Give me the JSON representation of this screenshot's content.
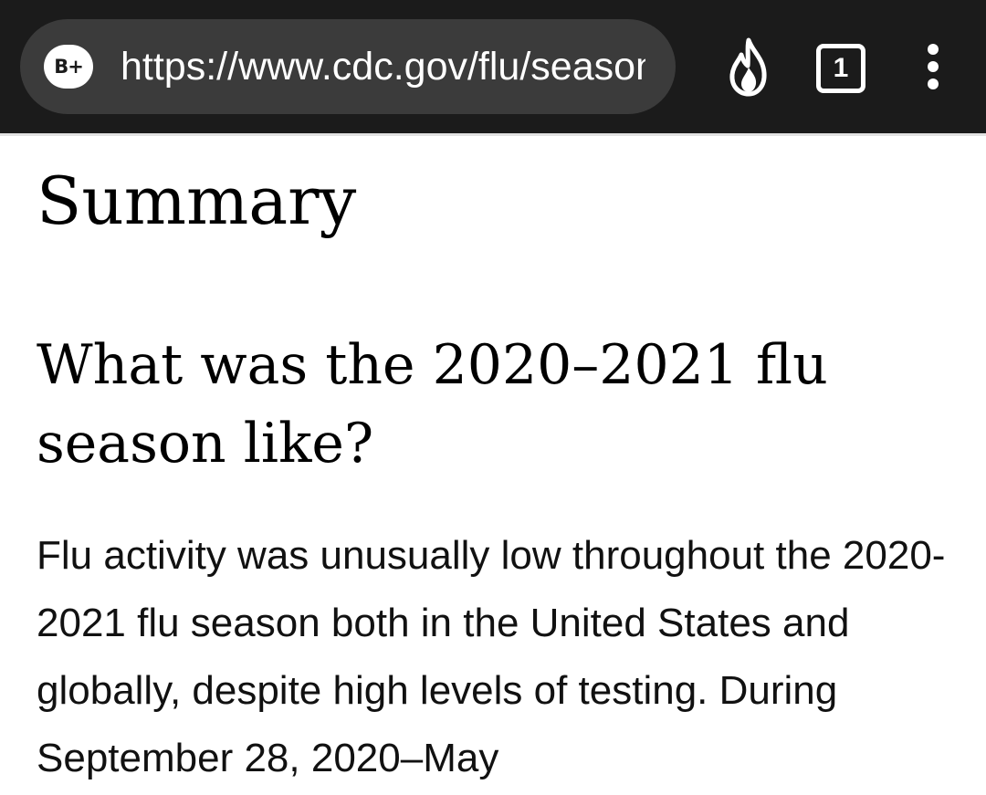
{
  "browser": {
    "badge_label": "B+",
    "url": "https://www.cdc.gov/flu/season",
    "tab_count": "1",
    "icons": {
      "badge": "privacy-grade-icon",
      "fire": "fire-icon",
      "tabs": "tab-switcher-icon",
      "menu": "overflow-menu-icon"
    }
  },
  "page": {
    "title": "Summary",
    "section_heading": "What was the 2020–2021 flu season like?",
    "body_text": "Flu activity was unusually low throughout the 2020-2021 flu season both in the United States and globally, despite high levels of testing. During September 28, 2020–May"
  },
  "colors": {
    "toolbar_bg": "#1b1b1b",
    "url_bar_bg": "#3b3b3b",
    "page_bg": "#ffffff",
    "text": "#000000"
  }
}
